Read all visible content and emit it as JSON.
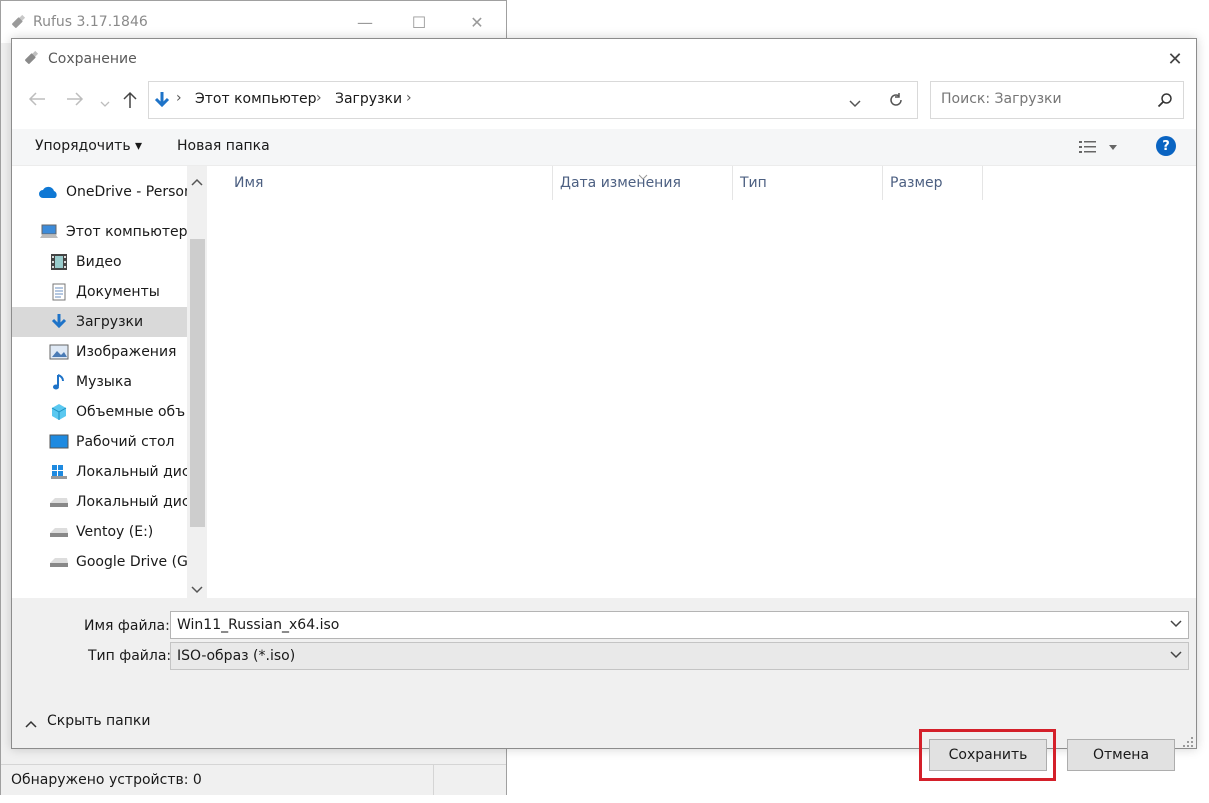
{
  "rufus": {
    "title": "Rufus 3.17.1846",
    "status_text": "Обнаружено устройств: 0",
    "controls": {
      "minimize": "—",
      "maximize": "☐",
      "close": "✕"
    }
  },
  "dialog": {
    "title": "Сохранение",
    "close": "✕",
    "breadcrumb": [
      "Этот компьютер",
      "Загрузки"
    ],
    "search_placeholder": "Поиск: Загрузки",
    "toolbar": {
      "organize": "Упорядочить ▾",
      "new_folder": "Новая папка",
      "help": "?"
    },
    "nav_items": [
      {
        "label": "OneDrive - Person",
        "icon": "onedrive-icon"
      },
      {
        "label": "Этот компьютер",
        "icon": "computer-icon"
      },
      {
        "label": "Видео",
        "icon": "video-icon"
      },
      {
        "label": "Документы",
        "icon": "documents-icon"
      },
      {
        "label": "Загрузки",
        "icon": "downloads-icon",
        "selected": true
      },
      {
        "label": "Изображения",
        "icon": "pictures-icon"
      },
      {
        "label": "Музыка",
        "icon": "music-icon"
      },
      {
        "label": "Объемные объ",
        "icon": "3d-objects-icon"
      },
      {
        "label": "Рабочий стол",
        "icon": "desktop-icon"
      },
      {
        "label": "Локальный дис",
        "icon": "windows-drive-icon"
      },
      {
        "label": "Локальный дис",
        "icon": "drive-icon"
      },
      {
        "label": "Ventoy (E:)",
        "icon": "drive-icon"
      },
      {
        "label": "Google Drive (G:",
        "icon": "drive-icon"
      }
    ],
    "columns": [
      "Имя",
      "Дата изменения",
      "Тип",
      "Размер"
    ],
    "file_name_label": "Имя файла:",
    "file_name_value": "Win11_Russian_x64.iso",
    "file_type_label": "Тип файла:",
    "file_type_value": "ISO-образ (*.iso)",
    "hide_folders": "Скрыть папки",
    "save_button": "Сохранить",
    "cancel_button": "Отмена"
  },
  "colors": {
    "highlight": "#d4202a",
    "accent": "#0a64c2"
  }
}
